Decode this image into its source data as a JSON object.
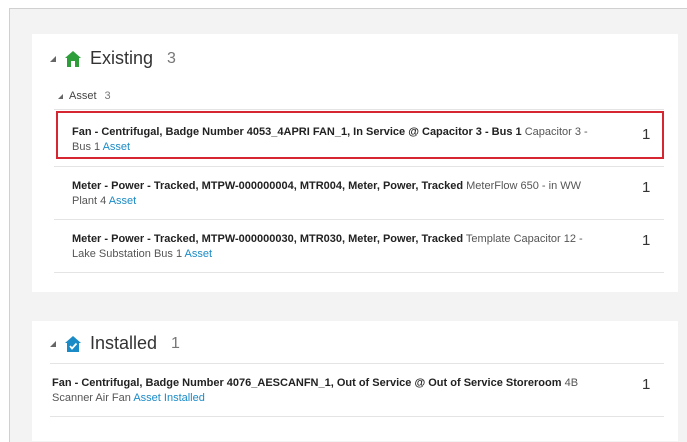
{
  "existing": {
    "title": "Existing",
    "count": "3",
    "icon": "house-icon",
    "asset_group": {
      "label": "Asset",
      "count": "3",
      "rows": [
        {
          "title": "Fan - Centrifugal, Badge Number 4053_4APRI FAN_1, In Service @ Capacitor 3 - Bus 1",
          "detail_line1": " Capacitor 3 -",
          "detail_line2": "Bus 1",
          "link": "Asset",
          "count": "1"
        },
        {
          "title": "Meter - Power - Tracked, MTPW-000000004, MTR004, Meter, Power, Tracked",
          "detail_line1": " MeterFlow 650 - in WW",
          "detail_line2": "Plant 4",
          "link": "Asset",
          "count": "1"
        },
        {
          "title": "Meter - Power - Tracked, MTPW-000000030, MTR030, Meter, Power, Tracked",
          "detail_line1": " Template Capacitor 12 -",
          "detail_line2": "Lake Substation Bus 1",
          "link": "Asset",
          "count": "1"
        }
      ]
    }
  },
  "installed": {
    "title": "Installed",
    "count": "1",
    "icon": "house-check-icon",
    "rows": [
      {
        "title": "Fan - Centrifugal, Badge Number 4076_AESCANFN_1, Out of Service @ Out of Service Storeroom",
        "detail_line1": " 4B",
        "detail_line2": "Scanner Air Fan",
        "link": "Asset Installed",
        "count": "1"
      }
    ]
  },
  "colors": {
    "accent_green": "#2e9e3a",
    "link": "#1a8bc7",
    "highlight": "#d62631",
    "installed_icon": "#1a8bc7"
  }
}
